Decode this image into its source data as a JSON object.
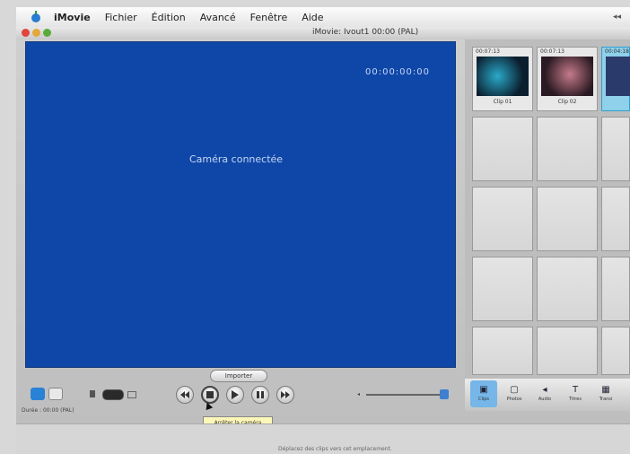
{
  "menu": {
    "apple": "apple-icon",
    "items": [
      {
        "label": "iMovie",
        "bold": true
      },
      {
        "label": "Fichier"
      },
      {
        "label": "Édition"
      },
      {
        "label": "Avancé"
      },
      {
        "label": "Fenêtre"
      },
      {
        "label": "Aide"
      }
    ],
    "right": "◂◂"
  },
  "window": {
    "title": "iMovie: Ivout1  00:00 (PAL)"
  },
  "monitor": {
    "timecode": "00:00:00:00",
    "message": "Caméra connectée"
  },
  "clips": [
    {
      "duration": "00:07:13",
      "name": "Clip 01",
      "thumb_color": "#1a6a86"
    },
    {
      "duration": "00:07:13",
      "name": "Clip 02",
      "thumb_color": "#7a4550"
    },
    {
      "duration": "00:04:18",
      "name": "",
      "thumb_color": "#2a3a6a",
      "selected": true
    }
  ],
  "controls": {
    "importer_label": "Importer",
    "tooltip": "Arrêter la caméra",
    "status": "Durée : 00:00 (PAL)",
    "timeline_hint": "Déplacez des clips vers cet emplacement."
  },
  "toolbar": {
    "tools": [
      {
        "label": "Clips",
        "icon": "clips-icon",
        "active": true
      },
      {
        "label": "Photos",
        "icon": "photos-icon"
      },
      {
        "label": "Audio",
        "icon": "audio-icon"
      },
      {
        "label": "Titres",
        "icon": "titles-icon"
      },
      {
        "label": "Transi",
        "icon": "transitions-icon"
      }
    ]
  },
  "colors": {
    "monitor_blue": "#0f47a8",
    "selection_blue": "#8fd0ea",
    "tooltip_yellow": "#fbf7b8"
  }
}
